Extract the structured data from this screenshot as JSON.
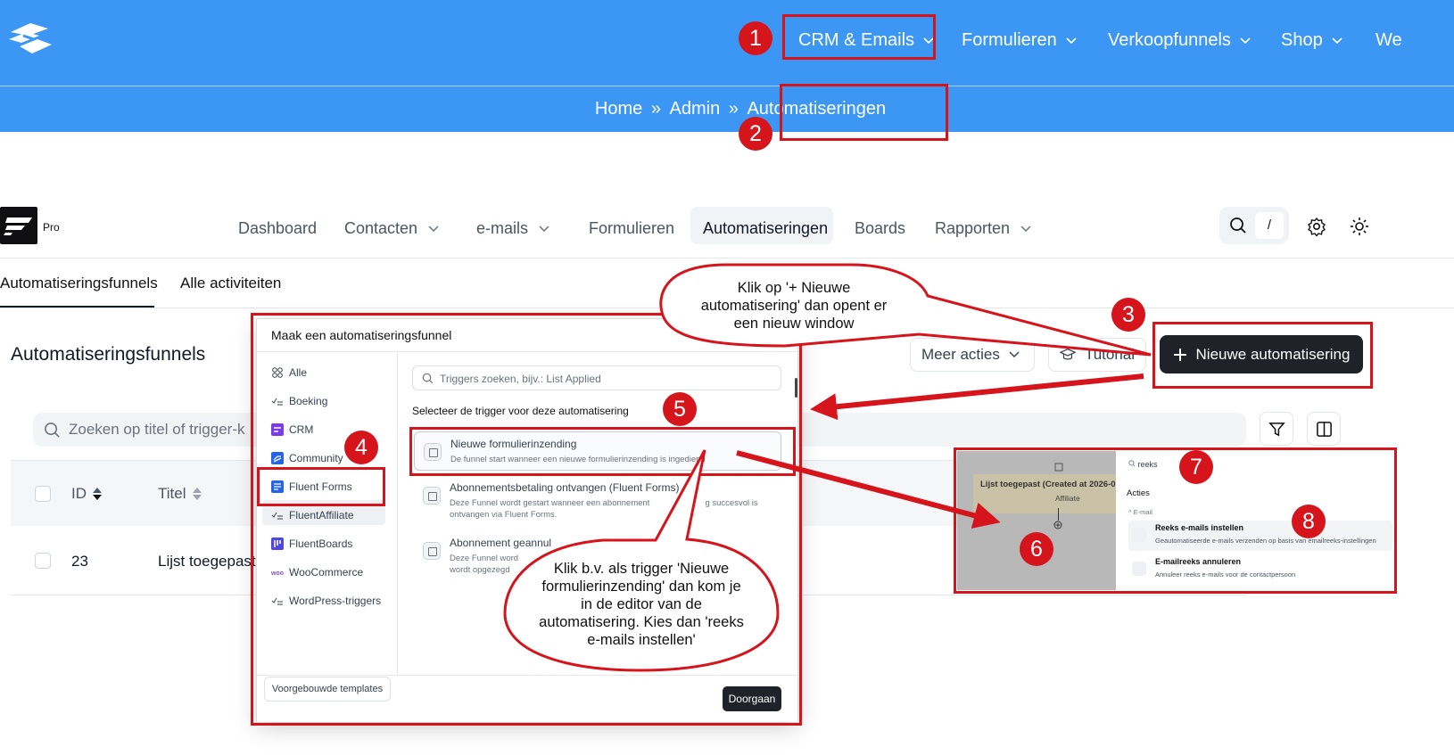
{
  "site": {
    "nav": [
      {
        "label": "CRM & Emails"
      },
      {
        "label": "Formulieren"
      },
      {
        "label": "Verkoopfunnels"
      },
      {
        "label": "Shop"
      },
      {
        "label": "We"
      }
    ],
    "breadcrumb": {
      "home": "Home",
      "sep": "»",
      "admin": "Admin",
      "current": "Automatiseringen"
    }
  },
  "app": {
    "pro_label": "Pro",
    "nav": {
      "dashboard": "Dashboard",
      "contacts": "Contacten",
      "emails": "e-mails",
      "forms": "Formulieren",
      "automations": "Automatiseringen",
      "boards": "Boards",
      "reports": "Rapporten"
    },
    "search_shortcut": "/",
    "subtabs": {
      "funnels": "Automatiseringsfunnels",
      "activities": "Alle activiteiten"
    },
    "section_title": "Automatiseringsfunnels",
    "more_actions": "Meer acties",
    "tutorial": "Tutorial",
    "new_automation": "Nieuwe automatisering",
    "search_placeholder": "Zoeken op titel of trigger-k",
    "table": {
      "col_id": "ID",
      "col_title": "Titel",
      "rows": [
        {
          "id": "23",
          "title": "Lijst toegepast"
        }
      ]
    }
  },
  "modal": {
    "title": "Maak een automatiseringsfunnel",
    "categories": {
      "all": "Alle",
      "booking": "Boeking",
      "crm": "CRM",
      "community": "Community",
      "fluent_forms": "Fluent Forms",
      "fluent_affiliate": "FluentAffiliate",
      "fluent_boards": "FluentBoards",
      "woocommerce": "WooCommerce",
      "wordpress": "WordPress-triggers"
    },
    "templates_button": "Voorgebouwde templates",
    "search_placeholder": "Triggers zoeken, bijv.: List Applied",
    "subtitle": "Selecteer de trigger voor deze automatisering",
    "triggers": [
      {
        "title": "Nieuwe formulierinzending",
        "desc": "De funnel start wanneer een nieuwe formulierinzending is ingediend",
        "desc2": ""
      },
      {
        "title": "Abonnementsbetaling ontvangen (Fluent Forms)",
        "desc": "Deze Funnel wordt gestart wanneer een abonnement",
        "desc_tail": "g succesvol is",
        "desc2": "ontvangen via Fluent Forms."
      },
      {
        "title": "Abonnement geannul",
        "desc": "Deze Funnel word",
        "desc2": "wordt opgezegd"
      }
    ],
    "continue_button": "Doorgaan"
  },
  "editor": {
    "node_title": "Lijst toegepast (Created at 2026-0",
    "node_sub": "Affiliate",
    "search_value": "reeks",
    "actions_heading": "Acties",
    "group_label": "E-mail",
    "items": [
      {
        "title": "Reeks e-mails instellen",
        "desc": "Geautomatiseerde e-mails verzenden op basis van emailreeks-instellingen"
      },
      {
        "title": "E-mailreeks annuleren",
        "desc": "Annuleer reeks e-mails voor de contactpersoon"
      }
    ]
  },
  "annotations": {
    "badges": [
      "1",
      "2",
      "3",
      "4",
      "5",
      "6",
      "7",
      "8"
    ],
    "callout_top": [
      "Klik op '+ Nieuwe",
      "automatisering' dan opent er",
      "een nieuw window"
    ],
    "callout_bottom": [
      "Klik b.v. als trigger 'Nieuwe",
      "formulierinzending' dan kom je",
      "in de editor van de",
      "automatisering. Kies dan 'reeks",
      "e-mails instellen'"
    ],
    "color": "#d6141b"
  },
  "colors": {
    "site_blue": "#3b97f3",
    "dark_button": "#1f2229",
    "annotation_red": "#d6141b"
  }
}
